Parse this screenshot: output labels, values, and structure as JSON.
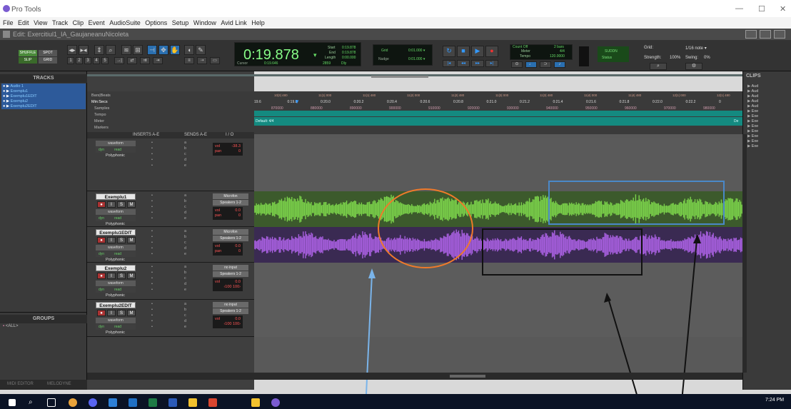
{
  "app": {
    "window_title": "Pro Tools",
    "menu": [
      "File",
      "Edit",
      "View",
      "Track",
      "Clip",
      "Event",
      "AudioSuite",
      "Options",
      "Setup",
      "Window",
      "Avid Link",
      "Help"
    ],
    "edit_window_title": "Edit: Exercitiul1_IA_GaujaneanuNicoleta"
  },
  "toolbar": {
    "modes": [
      "SHUFFLE",
      "SPOT",
      "SLIP",
      "GRID"
    ],
    "zoom_presets": [
      "1",
      "2",
      "3",
      "4",
      "5"
    ],
    "counter_main": "0:19.878",
    "counter_arrow": "▾",
    "start_label": "Start",
    "end_label": "End",
    "length_label": "Length",
    "start_value": "0:19.878",
    "end_value": "0:19.878",
    "length_value": "0:00.000",
    "cursor_label": "Cursor",
    "cursor_value": "0:19.646",
    "cursor_sample": "2859",
    "dly_label": "Dly",
    "grid_label": "Grid",
    "nudge_label": "Nudge",
    "grid_value": "0:01.000 ▾",
    "nudge_value": "0:01.000 ▾",
    "count_off": "Count Off",
    "count_off_val": "2 bars",
    "meter_label": "Meter",
    "meter_val": "4/4",
    "tempo_label": "Tempo",
    "tempo_val": "120.0000",
    "cuda_label": "SUDDN",
    "status_label": "Status",
    "grid_right": "Grid:",
    "grid_right_val": "1/16 note ▾",
    "strength_label": "Strength:",
    "strength_val": "100%",
    "swing_label": "Swing:",
    "swing_val": "0%"
  },
  "tracks_panel": {
    "title": "TRACKS",
    "items": [
      "Audio 1",
      "Exemplu1",
      "Exemplu1EDIT",
      "Exemplu2",
      "Exemplu2EDIT"
    ]
  },
  "groups_panel": {
    "title": "GROUPS",
    "item": "<ALL>"
  },
  "bottom_tabs": [
    "MIDI EDITOR",
    "MELODYNE"
  ],
  "clips_panel": {
    "title": "CLIPS",
    "items": [
      "Aud",
      "Aud",
      "Aud",
      "Aud",
      "Aud",
      "Exe",
      "Exe",
      "Exe",
      "Exe",
      "Exe",
      "Exe",
      "Exe",
      "Exe"
    ]
  },
  "rulers": {
    "labels": [
      "Bars|Beats",
      "Min:Secs",
      "Samples",
      "Tempo",
      "Meter",
      "Markers"
    ],
    "bars": [
      "10|3| 480",
      "11|1| 000",
      "11|1| 480",
      "11|2| 000",
      "11|2| 480",
      "11|3| 000",
      "11|3| 480",
      "11|4| 000",
      "11|4| 480",
      "12|1| 000",
      "12|1| 480"
    ],
    "mins": [
      "19.6",
      "0:19.8",
      "0:20.0",
      "0:20.2",
      "0:20.4",
      "0:20.6",
      "0:20.8",
      "0:21.0",
      "0:21.2",
      "0:21.4",
      "0:21.6",
      "0:21.8",
      "0:22.0",
      "0:22.2",
      "0"
    ],
    "samples": [
      "870000",
      "880000",
      "890000",
      "900000",
      "910000",
      "920000",
      "930000",
      "940000",
      "950000",
      "960000",
      "970000",
      "980000"
    ],
    "meter_start": "Default: 4/4",
    "meter_end": "De"
  },
  "mix_header": {
    "inserts": "INSERTS A-E",
    "sends": "SENDS A-E",
    "io": "I / O"
  },
  "tracks": [
    {
      "name": "",
      "view": "waveform",
      "dyn": "dyn",
      "read": "read",
      "poly": "Polyphonic",
      "io_in": "",
      "io_out": "",
      "vol_label": "vol",
      "vol": "-38.3",
      "pan_label": "pan",
      "pan": "0",
      "sends": [
        "a",
        "b",
        "c",
        "d",
        "e"
      ]
    },
    {
      "name": "Exemplu1",
      "view": "waveform",
      "dyn": "dyn",
      "read": "read",
      "poly": "Polyphonic",
      "io_in": "Microfon",
      "io_out": "Speakers 1-2",
      "vol_label": "vol",
      "vol": "0.0",
      "pan_label": "pan",
      "pan": "0",
      "sends": [
        "a",
        "b",
        "c",
        "d",
        "e"
      ]
    },
    {
      "name": "Exemplu1EDIT",
      "view": "waveform",
      "dyn": "dyn",
      "read": "read",
      "poly": "Polyphonic",
      "io_in": "Microfon",
      "io_out": "Speakers 1-2",
      "vol_label": "vol",
      "vol": "0.0",
      "pan_label": "pan",
      "pan": "0",
      "sends": [
        "a",
        "b",
        "c",
        "d",
        "e"
      ]
    },
    {
      "name": "Exemplu2",
      "view": "waveform",
      "dyn": "dyn",
      "read": "read",
      "poly": "Polyphonic",
      "io_in": "no input",
      "io_out": "Speakers 1-2",
      "vol_label": "vol",
      "vol": "0.0",
      "pan_label": "",
      "pan": "‹100 100›",
      "sends": [
        "a",
        "b",
        "c",
        "d",
        "e"
      ]
    },
    {
      "name": "Exemplu2EDIT",
      "view": "waveform",
      "dyn": "dyn",
      "read": "read",
      "poly": "Polyphonic",
      "io_in": "no input",
      "io_out": "Speakers 1-2",
      "vol_label": "vol",
      "vol": "0.0",
      "pan_label": "",
      "pan": "‹100 100›",
      "sends": [
        "a",
        "b",
        "c",
        "d",
        "e"
      ]
    }
  ],
  "colors": {
    "green_clip": "#7ad14a",
    "green_clip_bg": "#3e5a2c",
    "purple_clip": "#a85fe0",
    "purple_clip_bg": "#3a2a52",
    "orange_annot": "#f07a2a",
    "blue_annot": "#4a88c8",
    "black_annot": "#111111",
    "lightblue_arrow": "#7ab4ea",
    "counter_green": "#8f8"
  },
  "taskbar": {
    "time": "7:24 PM"
  }
}
